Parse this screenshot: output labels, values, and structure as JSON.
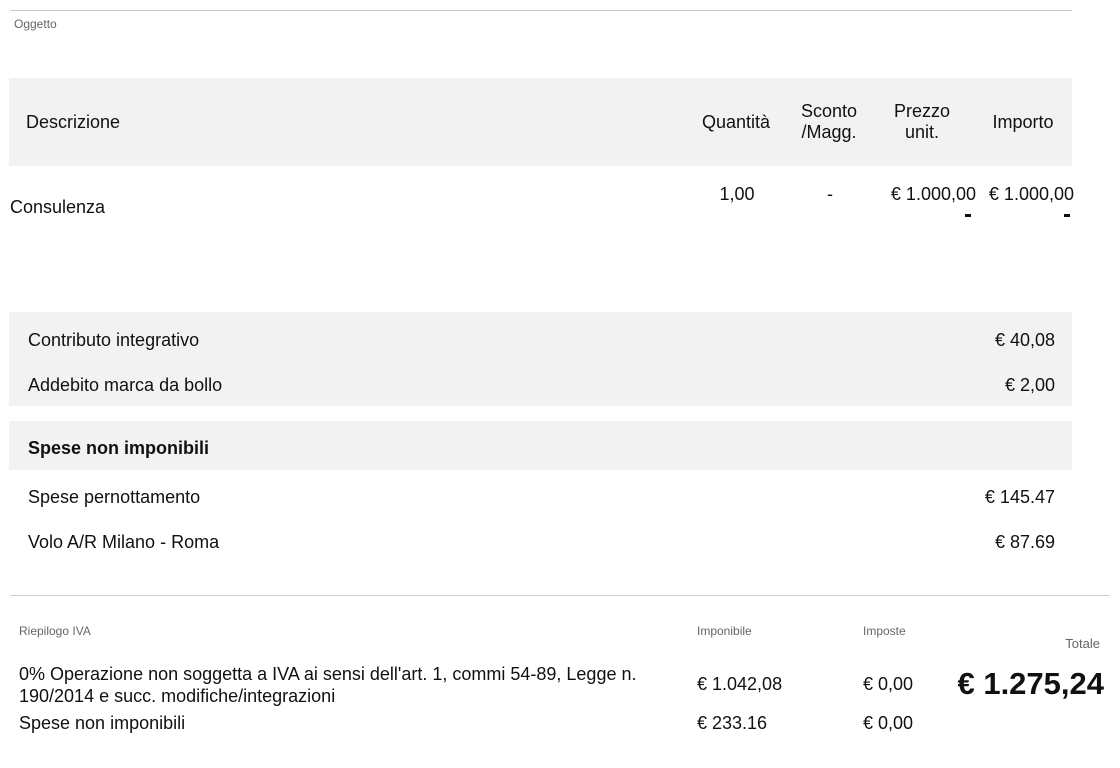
{
  "oggetto_label": "Oggetto",
  "table": {
    "headers": {
      "descrizione": "Descrizione",
      "quantita": "Quantità",
      "sconto_line1": "Sconto",
      "sconto_line2": "/Magg.",
      "prezzo_line1": "Prezzo",
      "prezzo_line2": "unit.",
      "importo": "Importo"
    },
    "rows": [
      {
        "descrizione": "Consulenza",
        "quantita": "1,00",
        "sconto": "-",
        "prezzo": "€ 1.000,00",
        "importo": "€ 1.000,00"
      }
    ]
  },
  "contributi": [
    {
      "label": "Contributo integrativo",
      "value": "€ 40,08"
    },
    {
      "label": "Addebito marca da bollo",
      "value": "€ 2,00"
    }
  ],
  "spese_non_imponibili": {
    "title": "Spese non imponibili",
    "items": [
      {
        "label": "Spese pernottamento",
        "value": "€ 145.47"
      },
      {
        "label": "Volo A/R Milano - Roma",
        "value": "€ 87.69"
      }
    ]
  },
  "riepilogo": {
    "title": "Riepilogo IVA",
    "imponibile_label": "Imponibile",
    "imposte_label": "Imposte",
    "totale_label": "Totale",
    "rows": [
      {
        "descrizione": "0% Operazione non soggetta a IVA ai sensi dell'art. 1, commi 54-89, Legge n. 190/2014 e succ. modifiche/integrazioni",
        "imponibile": "€ 1.042,08",
        "imposte": "€ 0,00"
      },
      {
        "descrizione": "Spese non imponibili",
        "imponibile": "€ 233.16",
        "imposte": "€ 0,00"
      }
    ],
    "totale": "€ 1.275,24"
  }
}
